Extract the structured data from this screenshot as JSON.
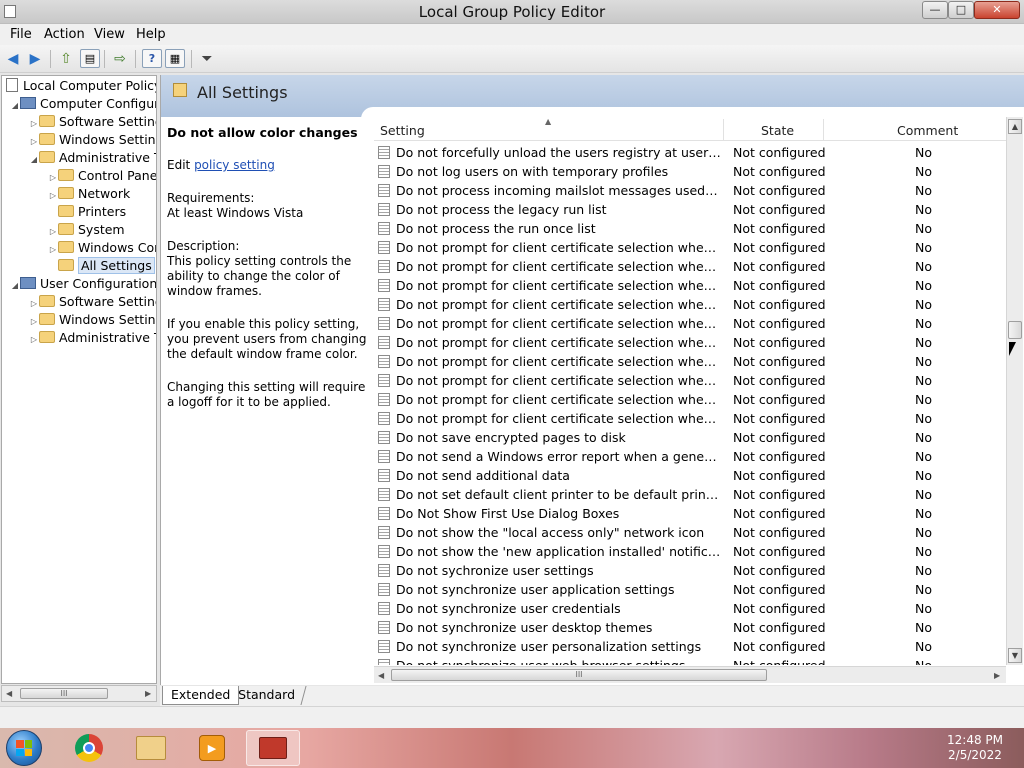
{
  "window": {
    "title": "Local Group Policy Editor",
    "controls": {
      "minimize": "—",
      "maximize": "□",
      "close": "✕"
    }
  },
  "menu": [
    "File",
    "Action",
    "View",
    "Help"
  ],
  "toolbar": {
    "icons": [
      "back-arrow-icon",
      "forward-arrow-icon",
      "up-folder-icon",
      "show-hide-tree-icon",
      "export-list-icon",
      "help-icon",
      "properties-pane-icon",
      "filter-icon"
    ]
  },
  "tree": {
    "root": "Local Computer Policy",
    "items": [
      {
        "label": "Computer Configura",
        "level": 1,
        "arrow": "◢",
        "icon": "pc"
      },
      {
        "label": "Software Settings",
        "level": 2,
        "arrow": "▷",
        "icon": "folder"
      },
      {
        "label": "Windows Setting",
        "level": 2,
        "arrow": "▷",
        "icon": "folder"
      },
      {
        "label": "Administrative Te",
        "level": 2,
        "arrow": "◢",
        "icon": "folder"
      },
      {
        "label": "Control Panel",
        "level": 3,
        "arrow": "▷",
        "icon": "folder"
      },
      {
        "label": "Network",
        "level": 3,
        "arrow": "▷",
        "icon": "folder"
      },
      {
        "label": "Printers",
        "level": 3,
        "arrow": "",
        "icon": "folder"
      },
      {
        "label": "System",
        "level": 3,
        "arrow": "▷",
        "icon": "folder"
      },
      {
        "label": "Windows Cor",
        "level": 3,
        "arrow": "▷",
        "icon": "folder"
      },
      {
        "label": "All Settings",
        "level": 3,
        "arrow": "",
        "icon": "folder",
        "selected": true
      },
      {
        "label": "User Configuration",
        "level": 1,
        "arrow": "◢",
        "icon": "pc"
      },
      {
        "label": "Software Settings",
        "level": 2,
        "arrow": "▷",
        "icon": "folder"
      },
      {
        "label": "Windows Setting",
        "level": 2,
        "arrow": "▷",
        "icon": "folder"
      },
      {
        "label": "Administrative Te",
        "level": 2,
        "arrow": "▷",
        "icon": "folder"
      }
    ]
  },
  "pane": {
    "title": "All Settings",
    "description": {
      "title": "Do not allow color changes",
      "edit_prefix": "Edit ",
      "edit_link": "policy setting",
      "requirements_label": "Requirements:",
      "requirements_value": "At least Windows Vista",
      "description_label": "Description:",
      "description_text": "This policy setting controls the ability to change the color of window frames.",
      "enable_text": "If you enable this policy setting, you prevent users from changing the default window frame color.",
      "logoff_text": "Changing this setting will require a logoff for it to be applied."
    }
  },
  "table": {
    "columns": [
      "Setting",
      "State",
      "Comment"
    ],
    "rows": [
      [
        "Do not forcefully unload the users registry at user logoff",
        "Not configured",
        "No"
      ],
      [
        "Do not log users on with temporary profiles",
        "Not configured",
        "No"
      ],
      [
        "Do not process incoming mailslot messages used for domai...",
        "Not configured",
        "No"
      ],
      [
        "Do not process the legacy run list",
        "Not configured",
        "No"
      ],
      [
        "Do not process the run once list",
        "Not configured",
        "No"
      ],
      [
        "Do not prompt for client certificate selection when no certifi...",
        "Not configured",
        "No"
      ],
      [
        "Do not prompt for client certificate selection when no certifi...",
        "Not configured",
        "No"
      ],
      [
        "Do not prompt for client certificate selection when no certifi...",
        "Not configured",
        "No"
      ],
      [
        "Do not prompt for client certificate selection when no certifi...",
        "Not configured",
        "No"
      ],
      [
        "Do not prompt for client certificate selection when no certifi...",
        "Not configured",
        "No"
      ],
      [
        "Do not prompt for client certificate selection when no certifi...",
        "Not configured",
        "No"
      ],
      [
        "Do not prompt for client certificate selection when no certifi...",
        "Not configured",
        "No"
      ],
      [
        "Do not prompt for client certificate selection when no certifi...",
        "Not configured",
        "No"
      ],
      [
        "Do not prompt for client certificate selection when no certifi...",
        "Not configured",
        "No"
      ],
      [
        "Do not prompt for client certificate selection when no certifi...",
        "Not configured",
        "No"
      ],
      [
        "Do not save encrypted pages to disk",
        "Not configured",
        "No"
      ],
      [
        "Do not send a Windows error report when a generic driver is...",
        "Not configured",
        "No"
      ],
      [
        "Do not send additional data",
        "Not configured",
        "No"
      ],
      [
        "Do not set default client printer to be default printer in a ses...",
        "Not configured",
        "No"
      ],
      [
        "Do Not Show First Use Dialog Boxes",
        "Not configured",
        "No"
      ],
      [
        "Do not show the \"local access only\" network icon",
        "Not configured",
        "No"
      ],
      [
        "Do not show the 'new application installed' notification",
        "Not configured",
        "No"
      ],
      [
        "Do not sychronize user settings",
        "Not configured",
        "No"
      ],
      [
        "Do not synchronize user application settings",
        "Not configured",
        "No"
      ],
      [
        "Do not synchronize user credentials",
        "Not configured",
        "No"
      ],
      [
        "Do not synchronize user desktop themes",
        "Not configured",
        "No"
      ],
      [
        "Do not synchronize user personalization settings",
        "Not configured",
        "No"
      ],
      [
        "Do not synchronize user web browser settings",
        "Not configured",
        "No"
      ]
    ]
  },
  "tabs": [
    "Extended",
    "Standard"
  ],
  "scroll_glyphs": {
    "up": "▲",
    "down": "▼",
    "left": "◀",
    "right": "▶",
    "grip": "III",
    "sort": "▲"
  },
  "taskbar": {
    "apps": [
      "start-button",
      "chrome-app",
      "file-explorer-app",
      "media-player-app",
      "group-policy-app"
    ],
    "time": "12:48 PM",
    "date": "2/5/2022"
  }
}
